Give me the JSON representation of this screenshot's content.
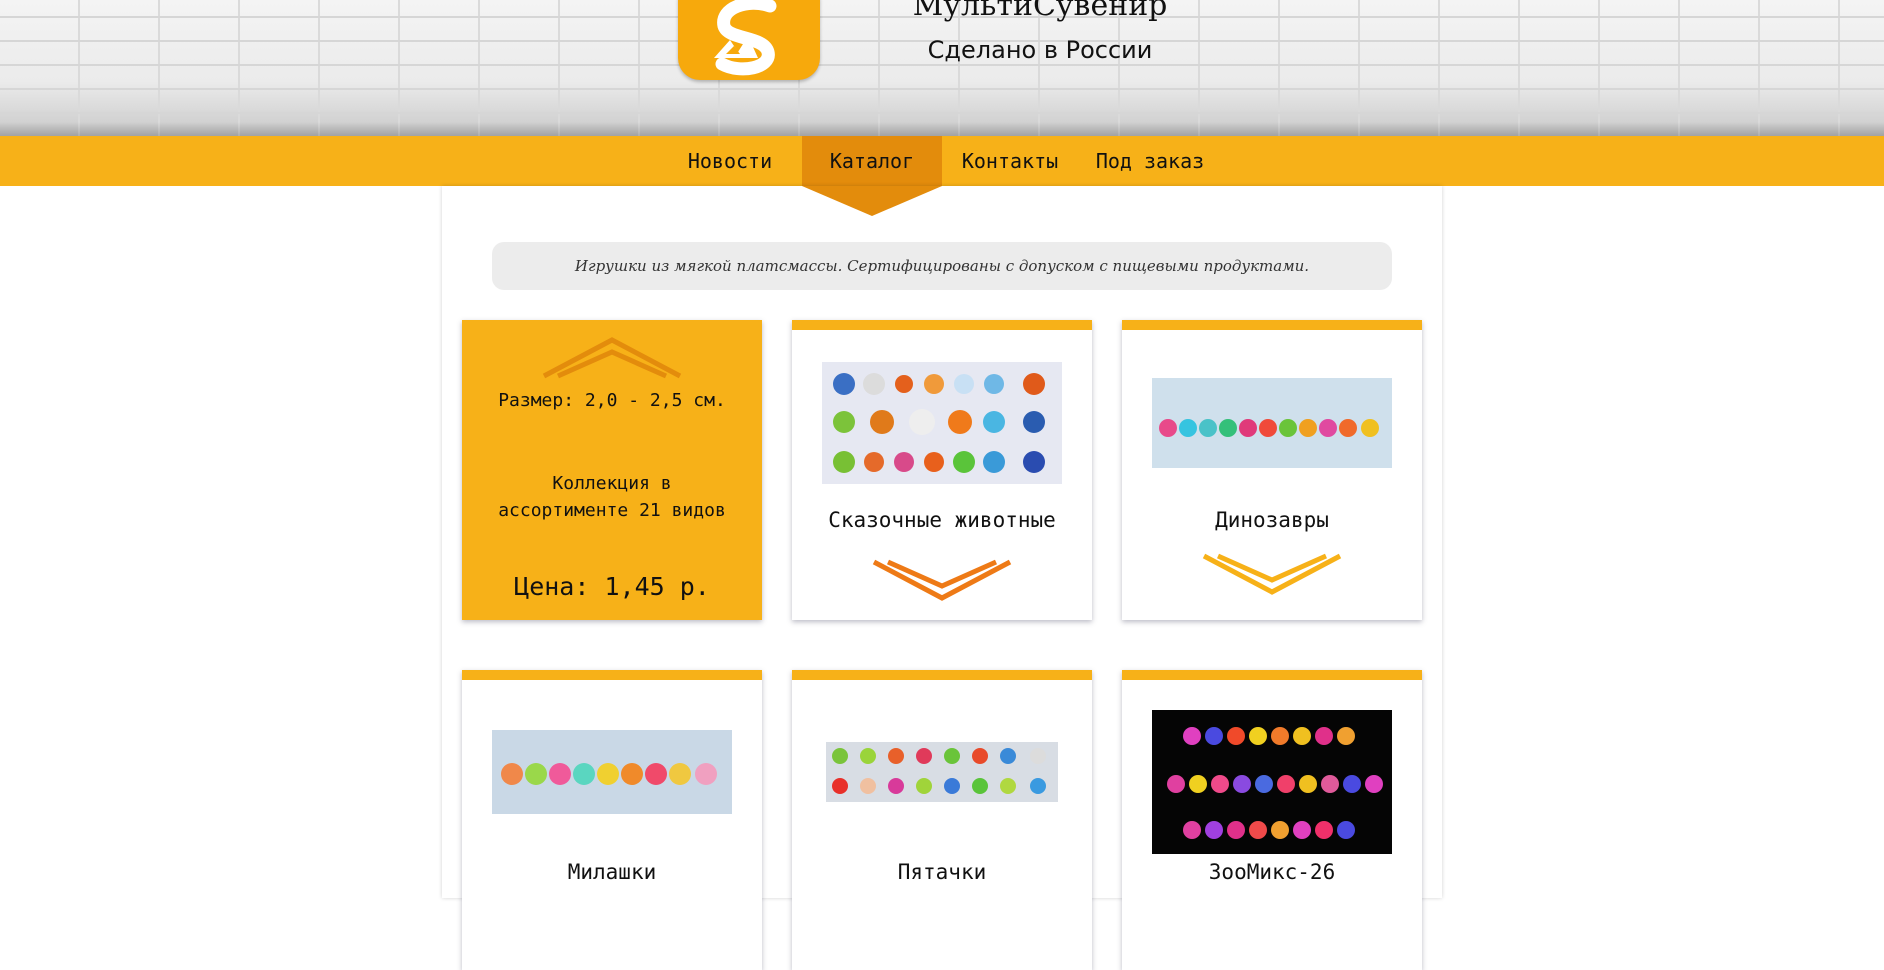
{
  "header": {
    "site_title": "МультиСувенир",
    "site_subtitle": "Сделано в России",
    "logo_icon": "logo-s-icon"
  },
  "nav": {
    "items": [
      {
        "label": "Новости",
        "active": false
      },
      {
        "label": "Каталог",
        "active": true
      },
      {
        "label": "Контакты",
        "active": false
      },
      {
        "label": "Под заказ",
        "active": false
      }
    ]
  },
  "notice": "Игрушки из мягкой платсмассы. Сертифицированы с допуском с пищевыми продуктами.",
  "info_card": {
    "size": "Размер: 2,0 - 2,5 см.",
    "collection": "Коллекция в ассортименте 21 видов",
    "price": "Цена: 1,45 р."
  },
  "cards": [
    {
      "title": "Сказочные животные"
    },
    {
      "title": "Динозавры"
    },
    {
      "title": "Милашки"
    },
    {
      "title": "Пятачки"
    },
    {
      "title": "ЗооМикс-26"
    }
  ],
  "colors": {
    "accent": "#f7b118",
    "accent_dark": "#e38c0c",
    "notice_bg": "#ececec"
  }
}
